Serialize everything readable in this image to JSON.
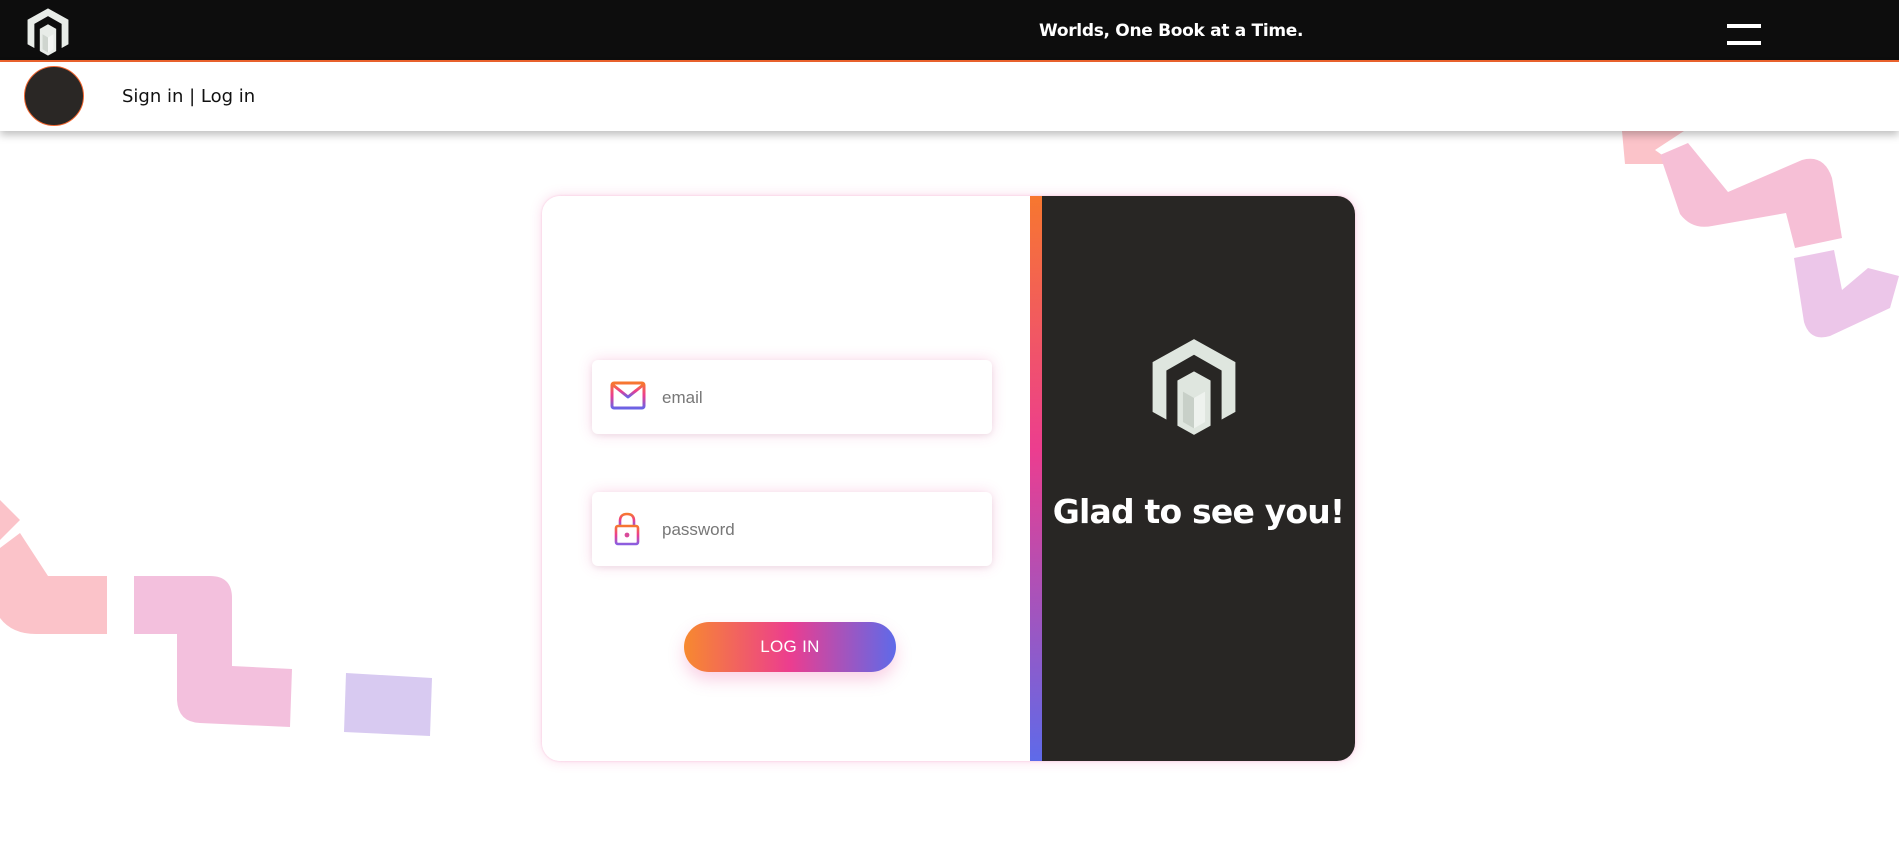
{
  "header": {
    "tagline": "Worlds, One Book at a Time.",
    "logo_icon": "hexagon-tower-logo-icon",
    "menu_icon": "hamburger-menu-icon"
  },
  "subheader": {
    "sign_in": "Sign in",
    "separator": " | ",
    "log_in": "Log in"
  },
  "login_form": {
    "email_placeholder": "email",
    "password_placeholder": "password",
    "email_icon": "mail-icon",
    "password_icon": "lock-icon",
    "submit_label": "LOG IN"
  },
  "welcome_panel": {
    "message": "Glad to see you!",
    "logo_icon": "hexagon-tower-logo-icon"
  },
  "colors": {
    "header_bg": "#0d0d0d",
    "accent_orange": "#f0652f",
    "gradient_start": "#f7892f",
    "gradient_mid": "#ec3d8f",
    "gradient_end": "#5e6ae9",
    "panel_dark": "#282624"
  }
}
